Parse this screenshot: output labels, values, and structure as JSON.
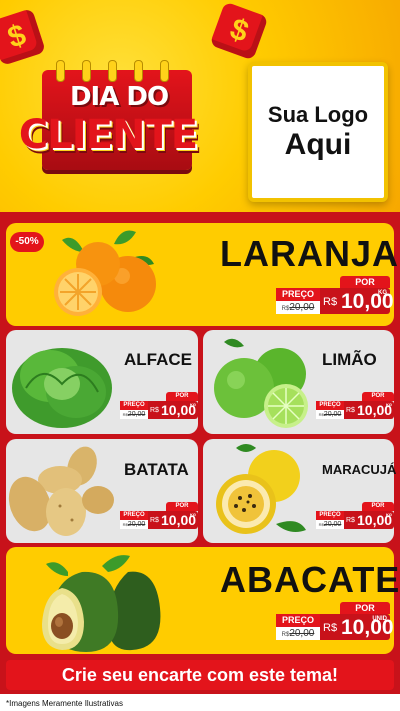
{
  "header": {
    "title_line1": "DIA DO",
    "title_line2": "CLIENTE",
    "die_symbol": "$",
    "logo_line1": "Sua Logo",
    "logo_line2": "Aqui"
  },
  "products": {
    "laranja": {
      "name": "LARANJA",
      "discount": "-50%",
      "por": "POR",
      "preco": "PREÇO",
      "old_prefix": "R$",
      "old": "20,00",
      "cur": "R$",
      "value": "10,00",
      "unit": "KG"
    },
    "alface": {
      "name": "ALFACE",
      "por": "POR",
      "preco": "PREÇO",
      "old_prefix": "R$",
      "old": "20,00",
      "cur": "R$",
      "value": "10,00",
      "unit": "KG"
    },
    "limao": {
      "name": "LIMÃO",
      "por": "POR",
      "preco": "PREÇO",
      "old_prefix": "R$",
      "old": "20,00",
      "cur": "R$",
      "value": "10,00",
      "unit": "KG"
    },
    "batata": {
      "name": "BATATA",
      "por": "POR",
      "preco": "PREÇO",
      "old_prefix": "R$",
      "old": "20,00",
      "cur": "R$",
      "value": "10,00",
      "unit": "KG"
    },
    "maracuja": {
      "name": "MARACUJÁ",
      "por": "POR",
      "preco": "PREÇO",
      "old_prefix": "R$",
      "old": "20,00",
      "cur": "R$",
      "value": "10,00",
      "unit": "KG"
    },
    "abacate": {
      "name": "ABACATE",
      "por": "POR",
      "preco": "PREÇO",
      "old_prefix": "R$",
      "old": "20,00",
      "cur": "R$",
      "value": "10,00",
      "unit": "UNID"
    }
  },
  "cta": {
    "label": "Crie seu encarte com este tema!"
  },
  "footnote": "*Imagens Meramente Ilustrativas",
  "colors": {
    "red": "#e3141b",
    "yellow": "#ffcc00",
    "card_grey": "#e6e6e6"
  }
}
